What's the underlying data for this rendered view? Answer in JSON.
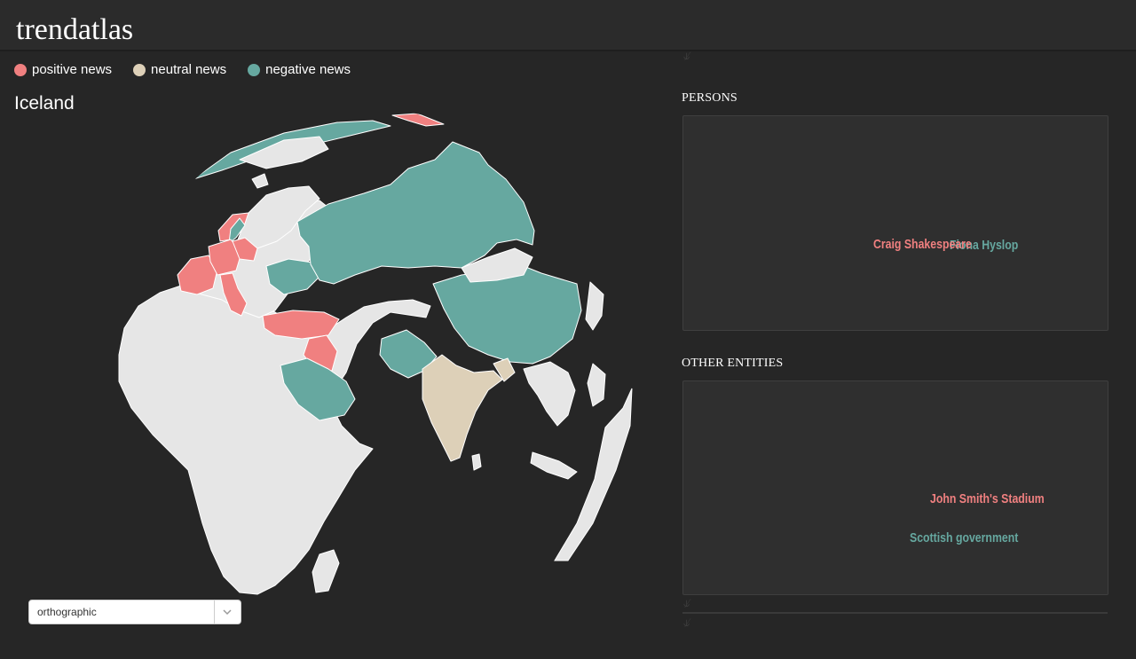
{
  "app": {
    "title": "trendatlas"
  },
  "legend": [
    {
      "label": "positive news",
      "color": "#f08080"
    },
    {
      "label": "neutral news",
      "color": "#ddd0b8"
    },
    {
      "label": "negative news",
      "color": "#66a8a0"
    }
  ],
  "colors": {
    "positive": "#f08080",
    "neutral": "#ddd0b8",
    "negative": "#66a8a0",
    "none": "#e6e6e6",
    "ocean": "#262626"
  },
  "map": {
    "selected_country": "Iceland",
    "projection": "orthographic",
    "positive_countries": [
      "France",
      "Germany",
      "Italy",
      "Turkey",
      "Iraq",
      "Norway",
      "Iceland",
      "Denmark"
    ],
    "neutral_countries": [
      "India",
      "Nepal"
    ],
    "negative_countries": [
      "Russia",
      "China",
      "Saudi Arabia",
      "Afghanistan",
      "Pakistan",
      "Ukraine",
      "Yemen",
      "Greenland",
      "Sweden",
      "Finland",
      "Belarus",
      "Jordan"
    ]
  },
  "panels": {
    "persons": {
      "title": "PERSONS",
      "words": [
        {
          "text": "Fiona Hyslop",
          "sentiment": "negative"
        },
        {
          "text": "Craig Shakespeare",
          "sentiment": "positive"
        }
      ]
    },
    "entities": {
      "title": "OTHER ENTITIES",
      "words": [
        {
          "text": "John Smith's Stadium",
          "sentiment": "positive"
        },
        {
          "text": "Scottish government",
          "sentiment": "negative"
        }
      ]
    }
  }
}
